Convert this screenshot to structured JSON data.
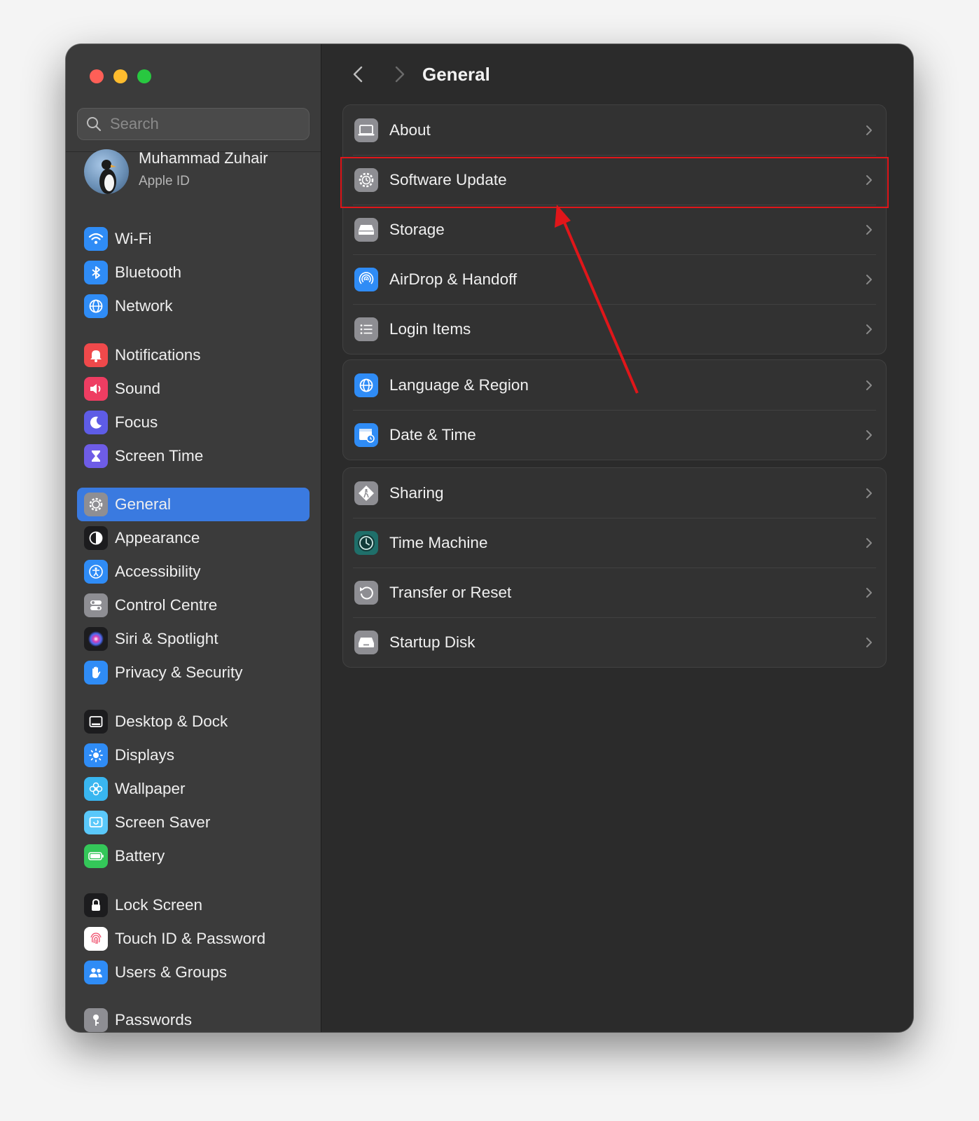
{
  "sidebar": {
    "search_placeholder": "Search",
    "profile": {
      "name": "Muhammad Zuhair",
      "subtitle": "Apple ID"
    },
    "items": [
      {
        "label": "Wi-Fi",
        "icon": "wifi-icon",
        "color": "#2f8cf6"
      },
      {
        "label": "Bluetooth",
        "icon": "bluetooth-icon",
        "color": "#2f8cf6"
      },
      {
        "label": "Network",
        "icon": "globe-icon",
        "color": "#2f8cf6"
      },
      {
        "label": "Notifications",
        "icon": "bell-icon",
        "color": "#f0494b"
      },
      {
        "label": "Sound",
        "icon": "speaker-icon",
        "color": "#ee3d62"
      },
      {
        "label": "Focus",
        "icon": "moon-icon",
        "color": "#5e5ce6"
      },
      {
        "label": "Screen Time",
        "icon": "hourglass-icon",
        "color": "#6e5ce6"
      },
      {
        "label": "General",
        "icon": "gear-icon",
        "color": "#8e8e93",
        "active": true
      },
      {
        "label": "Appearance",
        "icon": "appearance-icon",
        "color": "#1c1c1e"
      },
      {
        "label": "Accessibility",
        "icon": "accessibility-icon",
        "color": "#2f8cf6"
      },
      {
        "label": "Control Centre",
        "icon": "toggles-icon",
        "color": "#8e8e93"
      },
      {
        "label": "Siri & Spotlight",
        "icon": "siri-icon",
        "color": "#1c1c1e"
      },
      {
        "label": "Privacy & Security",
        "icon": "hand-icon",
        "color": "#2f8cf6"
      },
      {
        "label": "Desktop & Dock",
        "icon": "dock-icon",
        "color": "#1c1c1e"
      },
      {
        "label": "Displays",
        "icon": "sun-icon",
        "color": "#2f8cf6"
      },
      {
        "label": "Wallpaper",
        "icon": "flower-icon",
        "color": "#39b6f0"
      },
      {
        "label": "Screen Saver",
        "icon": "screensaver-icon",
        "color": "#5ac8fa"
      },
      {
        "label": "Battery",
        "icon": "battery-icon",
        "color": "#34c759"
      },
      {
        "label": "Lock Screen",
        "icon": "lock-icon",
        "color": "#1c1c1e"
      },
      {
        "label": "Touch ID & Password",
        "icon": "fingerprint-icon",
        "color": "#ffffff"
      },
      {
        "label": "Users & Groups",
        "icon": "users-icon",
        "color": "#2f8cf6"
      },
      {
        "label": "Passwords",
        "icon": "key-icon",
        "color": "#8e8e93"
      }
    ]
  },
  "main": {
    "title": "General",
    "groups": [
      [
        {
          "label": "About",
          "icon": "laptop-icon",
          "color": "#8e8e93"
        },
        {
          "label": "Software Update",
          "icon": "gear-badge-icon",
          "color": "#8e8e93"
        },
        {
          "label": "Storage",
          "icon": "drive-icon",
          "color": "#8e8e93"
        },
        {
          "label": "AirDrop & Handoff",
          "icon": "airdrop-icon",
          "color": "#2f8cf6"
        },
        {
          "label": "Login Items",
          "icon": "list-icon",
          "color": "#8e8e93"
        }
      ],
      [
        {
          "label": "Language & Region",
          "icon": "globe-icon",
          "color": "#2f8cf6"
        },
        {
          "label": "Date & Time",
          "icon": "calendar-clock-icon",
          "color": "#2f8cf6"
        }
      ],
      [
        {
          "label": "Sharing",
          "icon": "sharing-icon",
          "color": "#8e8e93"
        },
        {
          "label": "Time Machine",
          "icon": "time-machine-icon",
          "color": "#1f6f6a"
        },
        {
          "label": "Transfer or Reset",
          "icon": "reset-icon",
          "color": "#8e8e93"
        },
        {
          "label": "Startup Disk",
          "icon": "disk-icon",
          "color": "#8e8e93"
        }
      ]
    ]
  },
  "annotation": {
    "highlighted_row": "Software Update",
    "color": "#e0161a"
  }
}
